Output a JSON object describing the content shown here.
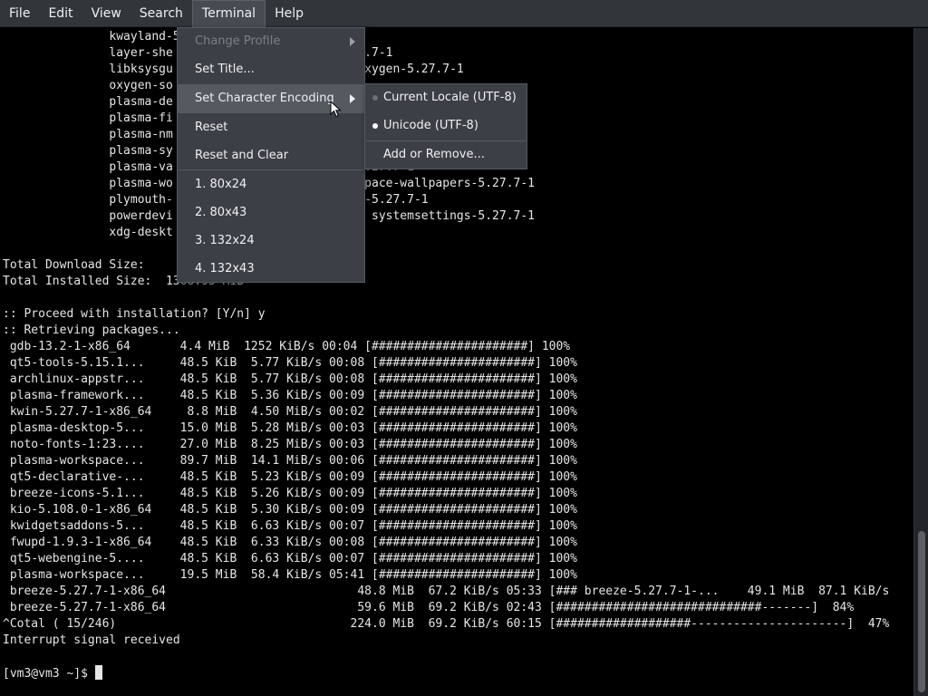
{
  "menubar": {
    "items": [
      "File",
      "Edit",
      "View",
      "Search",
      "Terminal",
      "Help"
    ]
  },
  "terminal": {
    "lines": [
      "               kwayland-5.27.7-1  kwrited-5.27.7-1",
      "               layer-she                      -5.27.7-1",
      "               libksysgu                       1  oxygen-5.27.7-1",
      "               oxygen-so",
      "               plasma-de",
      "               plasma-fi",
      "               plasma-nm                              .1-1",
      "               plasma-sy                              1",
      "               plasma-va                       me-5.27.7-1",
      "               plasma-wo                       orkspace-wallpapers-5.27.7-1",
      "               plymouth-                       gent-5.27.7-1",
      "               powerdevi                       7-1  systemsettings-5.27.7-1",
      "               xdg-deskt",
      "",
      "Total Download Size:",
      "Total Installed Size:  1368.95 MiB",
      "",
      ":: Proceed with installation? [Y/n] y",
      ":: Retrieving packages...",
      " gdb-13.2-1-x86_64       4.4 MiB  1252 KiB/s 00:04 [######################] 100%",
      " qt5-tools-5.15.1...     48.5 KiB  5.77 KiB/s 00:08 [######################] 100%",
      " archlinux-appstr...     48.5 KiB  5.77 KiB/s 00:08 [######################] 100%",
      " plasma-framework...     48.5 KiB  5.36 KiB/s 00:09 [######################] 100%",
      " kwin-5.27.7-1-x86_64     8.8 MiB  4.50 MiB/s 00:02 [######################] 100%",
      " plasma-desktop-5...     15.0 MiB  5.28 MiB/s 00:03 [######################] 100%",
      " noto-fonts-1:23....     27.0 MiB  8.25 MiB/s 00:03 [######################] 100%",
      " plasma-workspace...     89.7 MiB  14.1 MiB/s 00:06 [######################] 100%",
      " qt5-declarative-...     48.5 KiB  5.23 KiB/s 00:09 [######################] 100%",
      " breeze-icons-5.1...     48.5 KiB  5.26 KiB/s 00:09 [######################] 100%",
      " kio-5.108.0-1-x86_64    48.5 KiB  5.30 KiB/s 00:09 [######################] 100%",
      " kwidgetsaddons-5...     48.5 KiB  6.63 KiB/s 00:07 [######################] 100%",
      " fwupd-1.9.3-1-x86_64    48.5 KiB  6.33 KiB/s 00:08 [######################] 100%",
      " qt5-webengine-5....     48.5 KiB  6.63 KiB/s 00:07 [######################] 100%",
      " plasma-workspace...     19.5 MiB  58.4 KiB/s 05:41 [######################] 100%",
      " breeze-5.27.7-1-x86_64                           48.8 MiB  67.2 KiB/s 05:33 [### breeze-5.27.7-1-...    49.1 MiB  87.1 KiB/s",
      " breeze-5.27.7-1-x86_64                           59.6 MiB  69.2 KiB/s 02:43 [#############################-------]  84%",
      "^Cotal ( 15/246)                                 224.0 MiB  69.2 KiB/s 60:15 [###################----------------------]  47%",
      "Interrupt signal received",
      "",
      "[vm3@vm3 ~]$ "
    ]
  },
  "terminal_menu": {
    "change_profile": "Change Profile",
    "set_title": "Set Title...",
    "set_character_encoding": "Set Character Encoding",
    "reset": "Reset",
    "reset_and_clear": "Reset and Clear",
    "sizes": [
      "1. 80x24",
      "2. 80x43",
      "3. 132x24",
      "4. 132x43"
    ]
  },
  "encoding_submenu": {
    "current_locale": "Current Locale (UTF-8)",
    "unicode": "Unicode (UTF-8)",
    "add_or_remove": "Add or Remove..."
  },
  "colors": {
    "menubar_bg": "#31363b",
    "menu_bg": "#3c4046",
    "hover_bg": "#555a61",
    "terminal_bg": "#000000",
    "terminal_fg": "#e6e6e6"
  }
}
